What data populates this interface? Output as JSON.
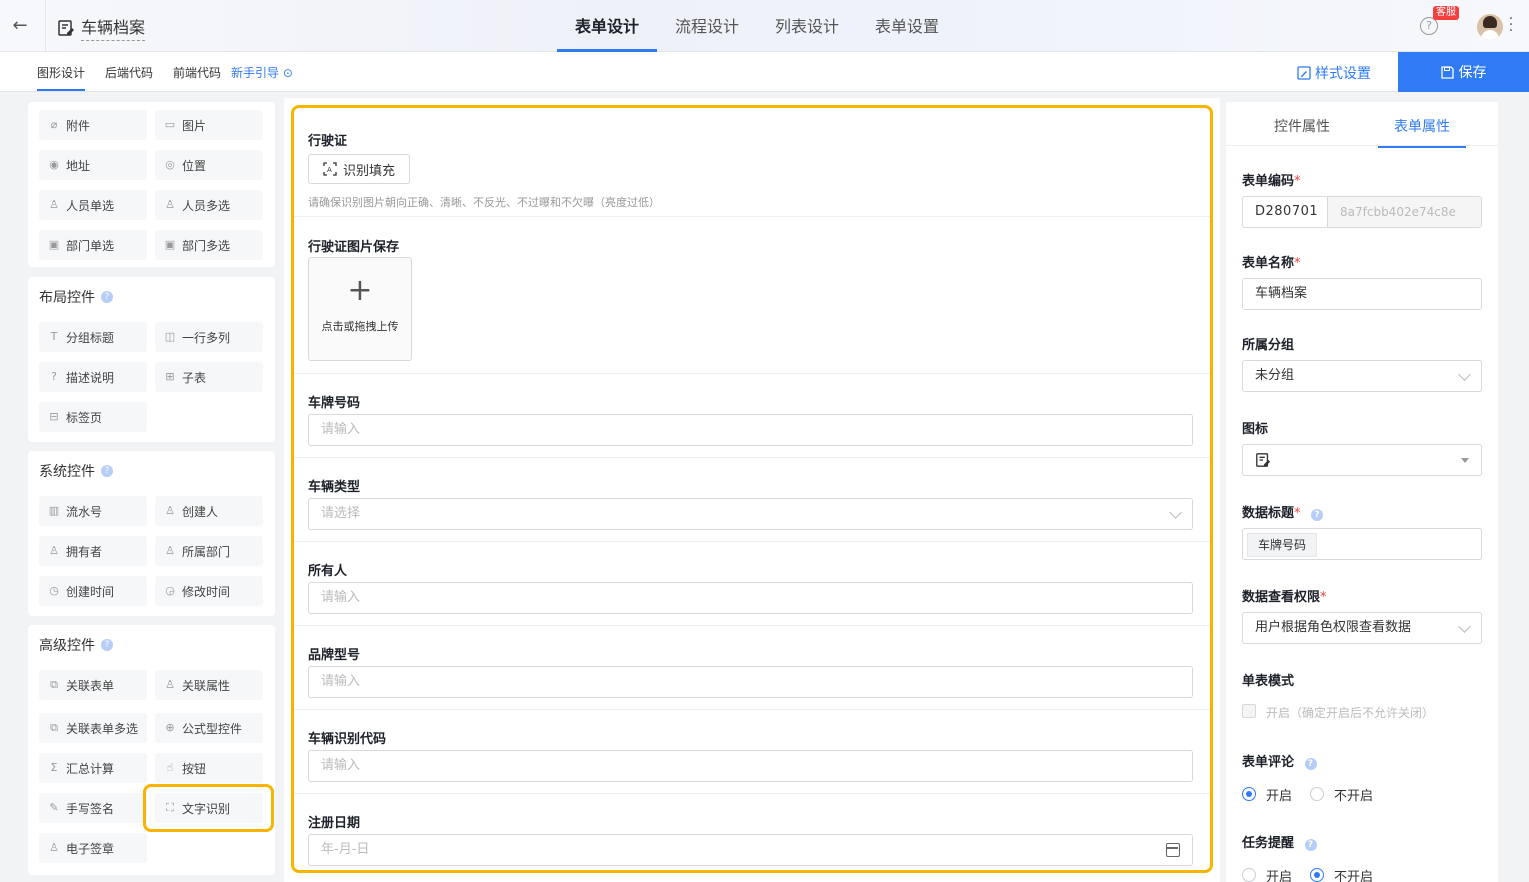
{
  "header": {
    "app_title": "车辆档案",
    "tabs": [
      "表单设计",
      "流程设计",
      "列表设计",
      "表单设置"
    ],
    "kefu": "客服",
    "help": "?"
  },
  "subbar": {
    "tabs": [
      "图形设计",
      "后端代码",
      "前端代码"
    ],
    "guide": "新手引导",
    "style_settings": "样式设置",
    "save": "保存"
  },
  "palette": {
    "basic": [
      "附件",
      "图片",
      "地址",
      "位置",
      "人员单选",
      "人员多选",
      "部门单选",
      "部门多选"
    ],
    "layout_title": "布局控件",
    "layout": [
      "分组标题",
      "一行多列",
      "描述说明",
      "子表",
      "标签页"
    ],
    "system_title": "系统控件",
    "system": [
      "流水号",
      "创建人",
      "拥有者",
      "所属部门",
      "创建时间",
      "修改时间"
    ],
    "advanced_title": "高级控件",
    "advanced": [
      "关联表单",
      "关联属性",
      "关联表单多选",
      "公式型控件",
      "汇总计算",
      "按钮",
      "手写签名",
      "文字识别",
      "电子签章"
    ]
  },
  "form": {
    "f1_label": "行驶证",
    "f1_button": "识别填充",
    "f1_hint": "请确保识别图片朝向正确、清晰、不反光、不过曝和不欠曝（亮度过低）",
    "f2_label": "行驶证图片保存",
    "f2_upload": "点击或拖拽上传",
    "f3_label": "车牌号码",
    "f3_placeholder": "请输入",
    "f4_label": "车辆类型",
    "f4_placeholder": "请选择",
    "f5_label": "所有人",
    "f5_placeholder": "请输入",
    "f6_label": "品牌型号",
    "f6_placeholder": "请输入",
    "f7_label": "车辆识别代码",
    "f7_placeholder": "请输入",
    "f8_label": "注册日期",
    "f8_placeholder": "年-月-日"
  },
  "right": {
    "tabs": [
      "控件属性",
      "表单属性"
    ],
    "code_label": "表单编码",
    "code_value": "D280701",
    "code_suffix": "8a7fcbb402e74c8e",
    "name_label": "表单名称",
    "name_value": "车辆档案",
    "group_label": "所属分组",
    "group_value": "未分组",
    "icon_label": "图标",
    "data_title_label": "数据标题",
    "data_title_tag": "车牌号码",
    "perm_label": "数据查看权限",
    "perm_value": "用户根据角色权限查看数据",
    "single_label": "单表模式",
    "single_text": "开启（确定开启后不允许关闭）",
    "comment_label": "表单评论",
    "comment_on": "开启",
    "comment_off": "不开启",
    "remind_label": "任务提醒",
    "remind_on": "开启",
    "remind_off": "不开启",
    "req_mark": "*"
  },
  "colors": {
    "primary": "#2f7bf5",
    "highlight": "#f7b500",
    "required": "#f53f3f"
  }
}
